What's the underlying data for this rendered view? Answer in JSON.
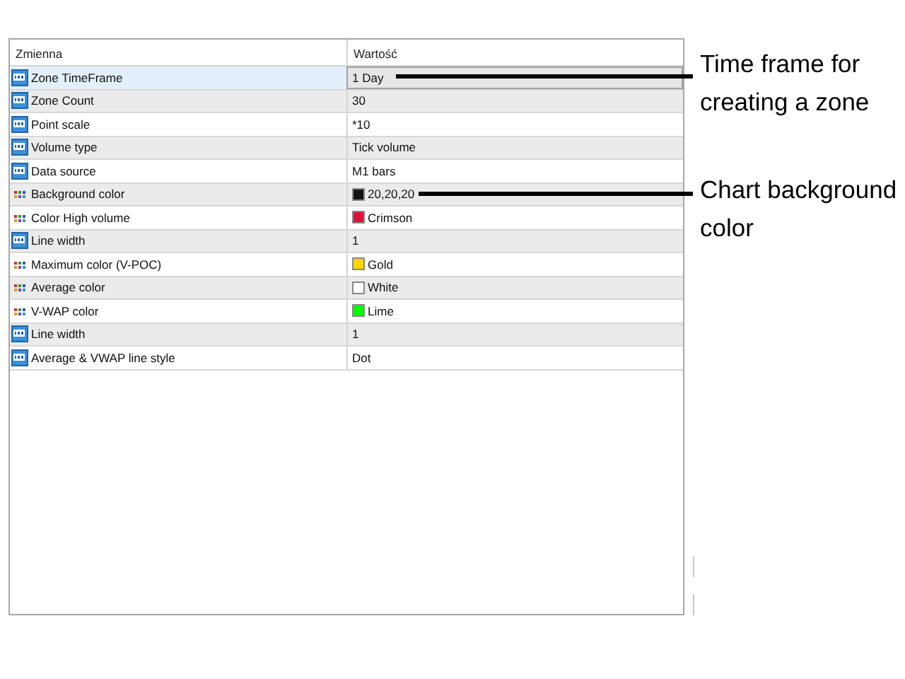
{
  "table": {
    "columns": [
      "Zmienna",
      "Wartość"
    ],
    "rows": [
      {
        "kind": "number",
        "name": "Zone TimeFrame",
        "value": "1 Day",
        "selected": true
      },
      {
        "kind": "number",
        "name": "Zone Count",
        "value": "30",
        "selected": false
      },
      {
        "kind": "number",
        "name": "Point scale",
        "value": "*10",
        "selected": false
      },
      {
        "kind": "number",
        "name": "Volume type",
        "value": "Tick volume",
        "selected": false
      },
      {
        "kind": "number",
        "name": "Data source",
        "value": "M1 bars",
        "selected": false
      },
      {
        "kind": "color",
        "name": "Background color",
        "value": "20,20,20",
        "color": "#141414",
        "selected": false
      },
      {
        "kind": "color",
        "name": "Color High volume",
        "value": "Crimson",
        "color": "#dc143c",
        "selected": false
      },
      {
        "kind": "number",
        "name": "Line width",
        "value": "1",
        "selected": false
      },
      {
        "kind": "color",
        "name": "Maximum color (V-POC)",
        "value": "Gold",
        "color": "#ffd700",
        "selected": false
      },
      {
        "kind": "color",
        "name": "Average color",
        "value": "White",
        "color": "#ffffff",
        "selected": false
      },
      {
        "kind": "color",
        "name": "V-WAP color",
        "value": "Lime",
        "color": "#00ff00",
        "selected": false
      },
      {
        "kind": "number",
        "name": "Line width",
        "value": "1",
        "selected": false
      },
      {
        "kind": "number",
        "name": "Average & VWAP line style",
        "value": "Dot",
        "selected": false
      }
    ]
  },
  "annotations": [
    {
      "text": "Time frame for creating a zone"
    },
    {
      "text": "Chart  background color"
    }
  ]
}
